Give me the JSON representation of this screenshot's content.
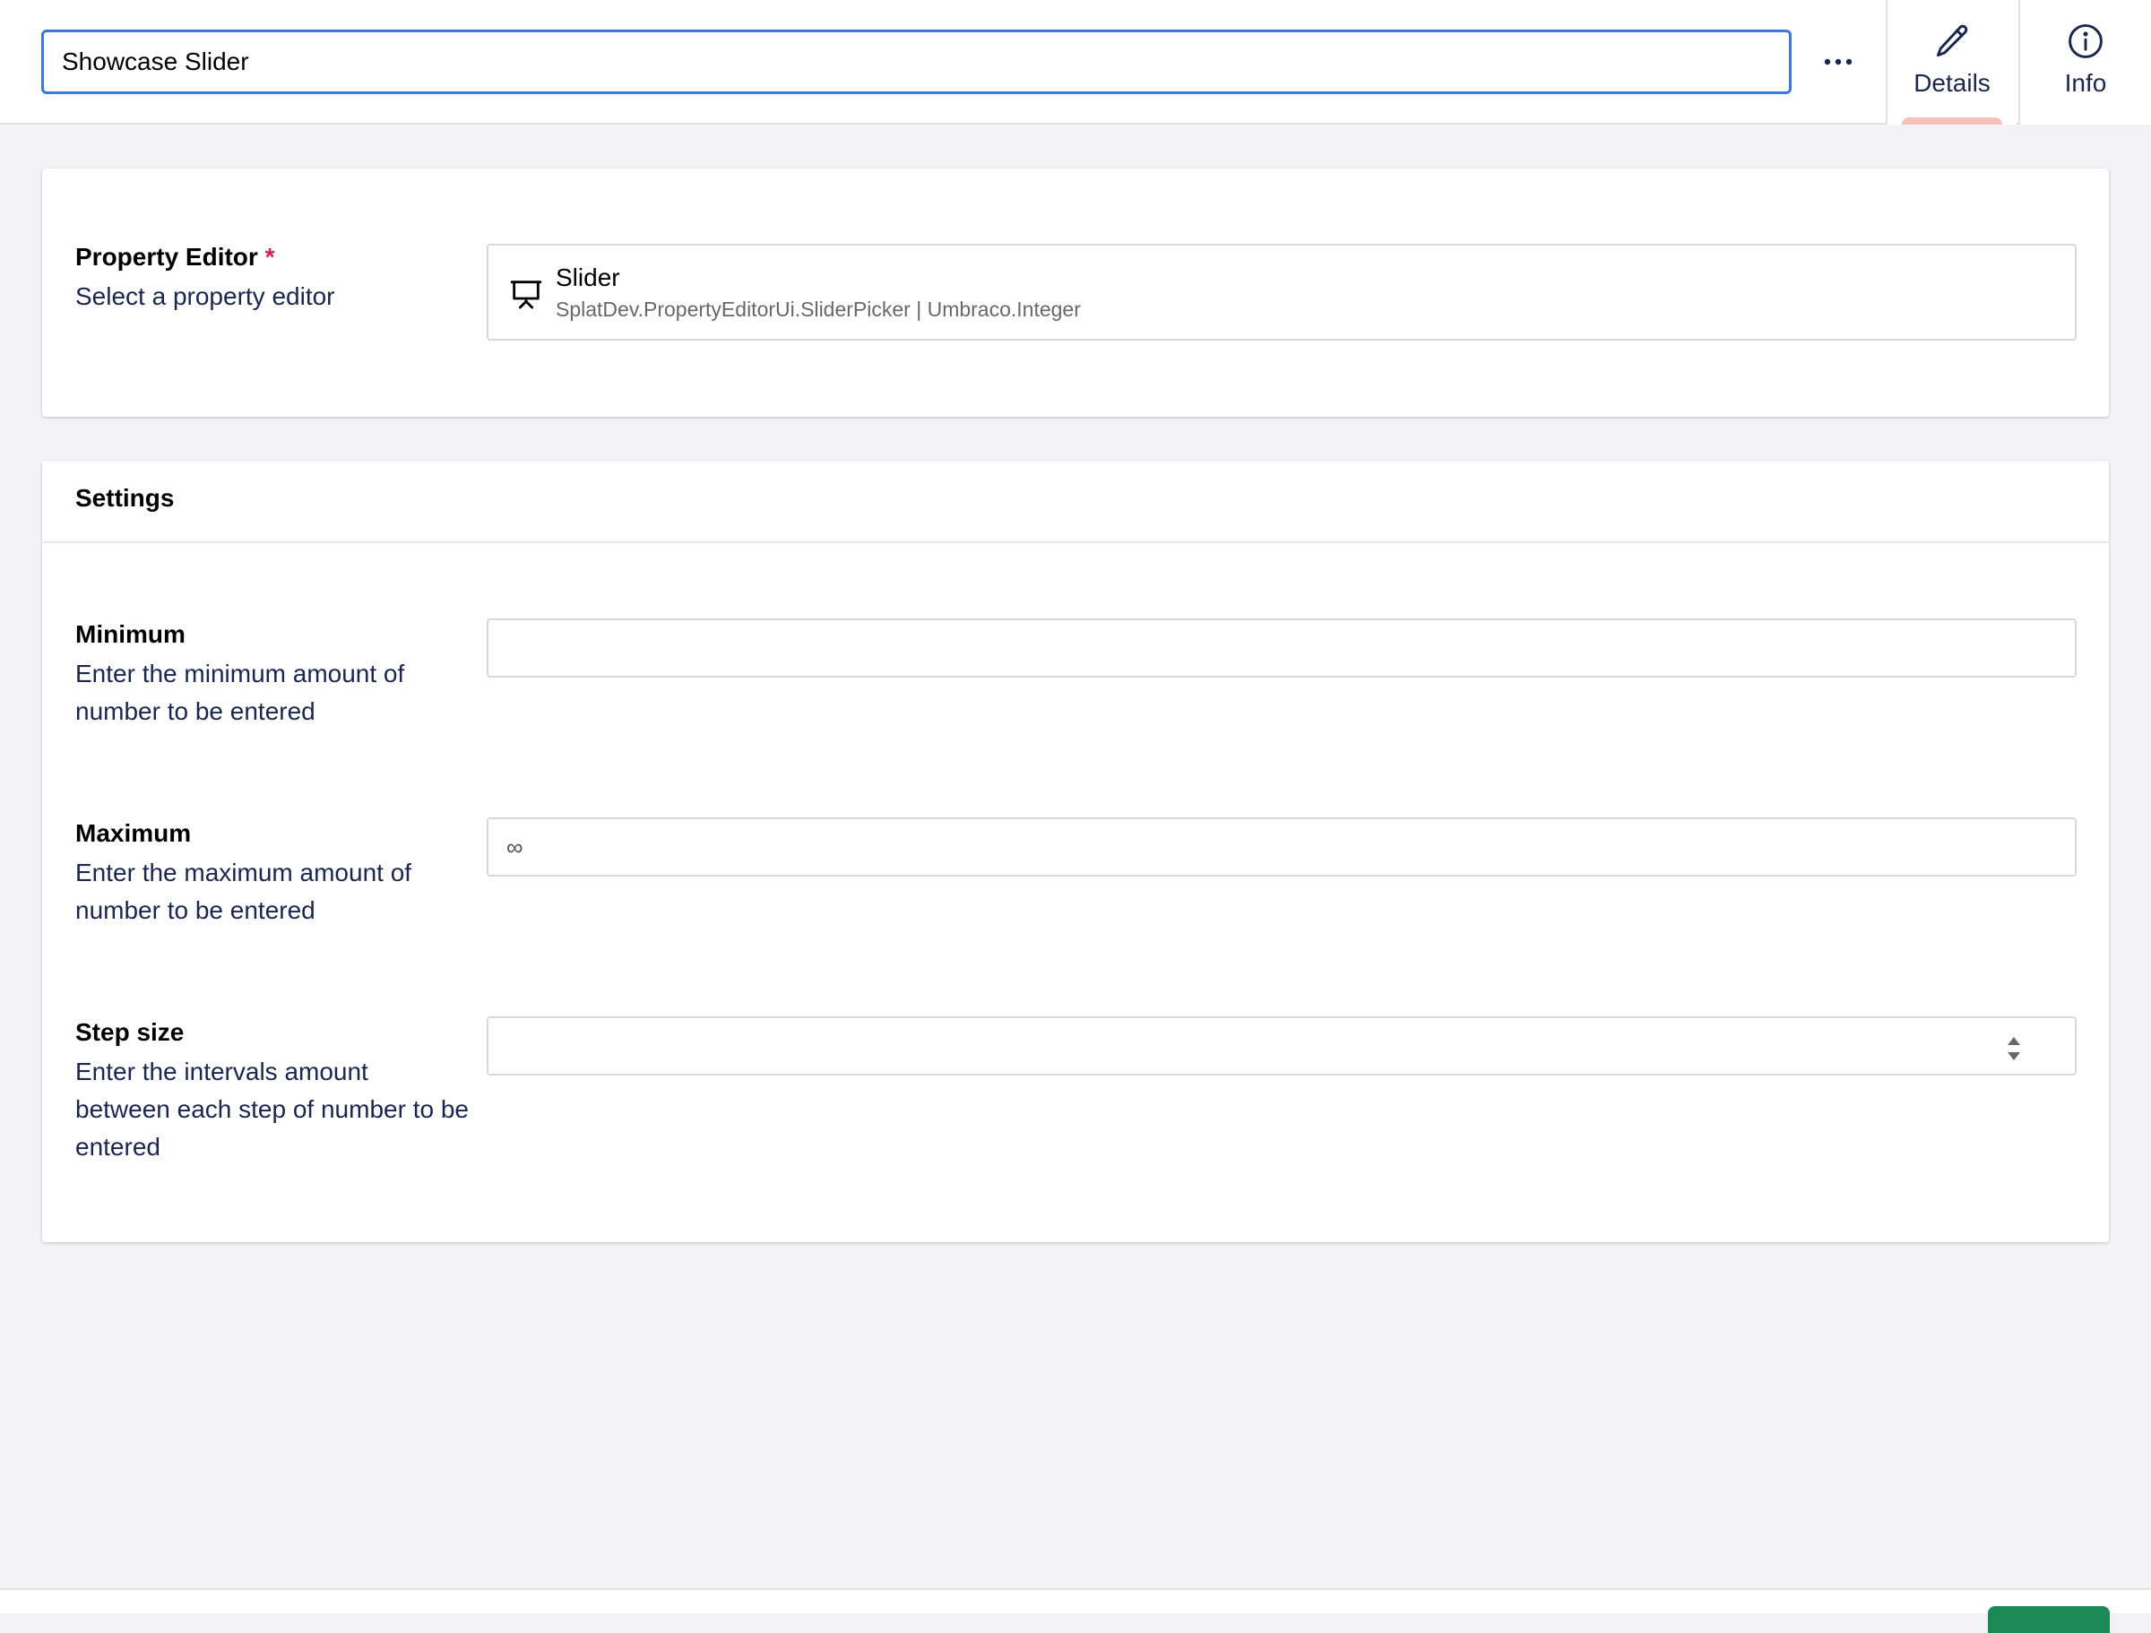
{
  "header": {
    "name_value": "Showcase Slider",
    "more_label": "...",
    "tabs": [
      {
        "label": "Details",
        "icon": "pencil-icon",
        "active": true
      },
      {
        "label": "Info",
        "icon": "info-icon",
        "active": false
      }
    ]
  },
  "property_editor": {
    "label": "Property Editor",
    "required_mark": "*",
    "description": "Select a property editor",
    "selected": {
      "icon": "presentation-icon",
      "name": "Slider",
      "alias": "SplatDev.PropertyEditorUi.SliderPicker | Umbraco.Integer"
    }
  },
  "settings": {
    "title": "Settings",
    "fields": [
      {
        "label": "Minimum",
        "description": "Enter the minimum amount of number to be entered",
        "value": "",
        "placeholder": ""
      },
      {
        "label": "Maximum",
        "description": "Enter the maximum amount of number to be entered",
        "value": "",
        "placeholder": "∞"
      },
      {
        "label": "Step size",
        "description": "Enter the intervals amount between each step of number to be entered",
        "value": "",
        "placeholder": ""
      }
    ]
  },
  "colors": {
    "focus_border": "#3879d9",
    "active_tab_indicator": "#f5c1bc",
    "required": "#d42054",
    "save_button": "#1c8a57"
  }
}
